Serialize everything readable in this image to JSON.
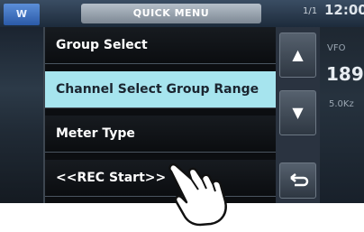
{
  "status_bar": {
    "mode": "W",
    "title": "QUICK MENU",
    "page": "1/1",
    "time": "12:00"
  },
  "menu": {
    "items": [
      {
        "label": "Group Select"
      },
      {
        "label": "Channel Select Group Range"
      },
      {
        "label": "Meter Type"
      },
      {
        "label": "<<REC Start>>"
      }
    ],
    "selected_index": 1
  },
  "scroll": {
    "up_icon": "triangle-up-icon",
    "down_icon": "triangle-down-icon",
    "back_icon": "return-icon"
  },
  "side_info": {
    "right_top": "VFO",
    "right_number": "189",
    "right_mid": "5.0Kz"
  },
  "overlay": {
    "icon": "tapping-hand-icon"
  }
}
